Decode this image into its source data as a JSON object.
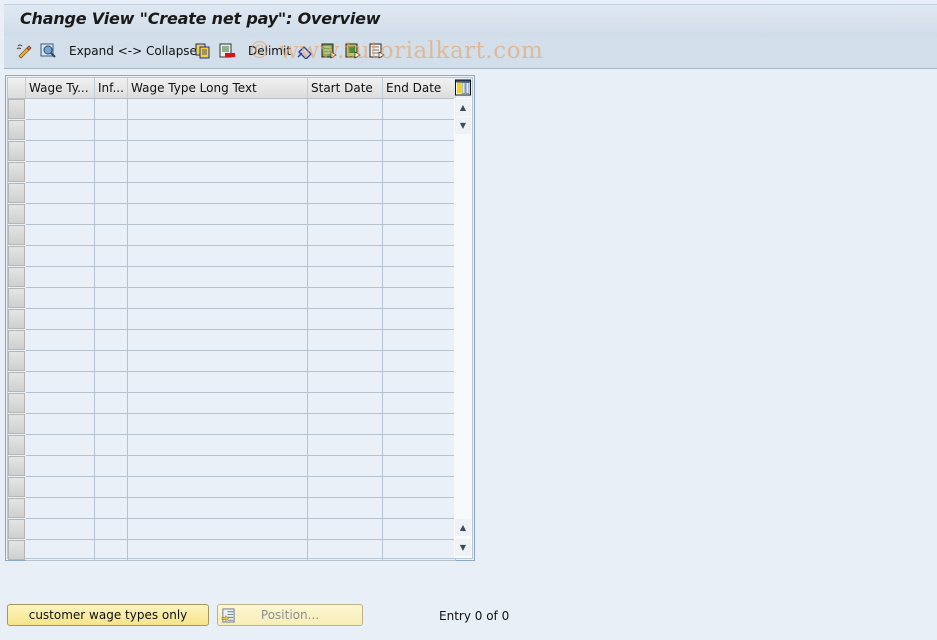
{
  "window": {
    "title": "Change View \"Create net pay\": Overview"
  },
  "toolbar": {
    "items": [
      {
        "type": "icon",
        "icon": "edit-pencil-icon"
      },
      {
        "type": "icon",
        "icon": "details-magnifier-icon"
      },
      {
        "type": "text",
        "label": "Expand <-> Collapse"
      },
      {
        "type": "icon",
        "icon": "copy-icon"
      },
      {
        "type": "icon",
        "icon": "delete-icon"
      },
      {
        "type": "text",
        "label": "Delimit"
      },
      {
        "type": "icon",
        "icon": "undo-change-icon"
      },
      {
        "type": "icon",
        "icon": "select-all-icon"
      },
      {
        "type": "icon",
        "icon": "select-block-icon"
      },
      {
        "type": "icon",
        "icon": "deselect-all-icon"
      }
    ],
    "expand_collapse_label": "Expand <-> Collapse",
    "delimit_label": "Delimit"
  },
  "watermark": "© www.tutorialkart.com",
  "table": {
    "columns": [
      "Wage Ty...",
      "Inf...",
      "Wage Type Long Text",
      "Start Date",
      "End Date"
    ],
    "row_count": 22,
    "rows": []
  },
  "footer": {
    "customer_button_label": "customer wage types only",
    "position_button_label": "Position...",
    "entry_status": "Entry 0 of 0"
  },
  "colors": {
    "background": "#e8eff6",
    "button_yellow": "#f6e48b",
    "watermark": "#e6a064"
  }
}
